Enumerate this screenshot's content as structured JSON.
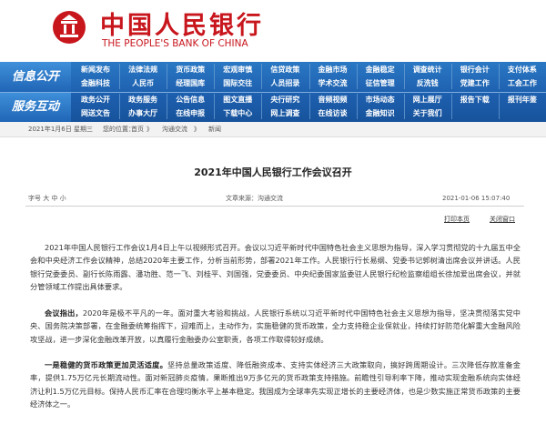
{
  "header": {
    "logo_cn": "中国人民银行",
    "logo_en": "THE PEOPLE'S BANK OF CHINA"
  },
  "nav": {
    "info_label": "信息公开",
    "service_label": "服务互动",
    "row1": [
      "新闻发布",
      "法律法规",
      "货币政策",
      "宏观审慎",
      "信贷政策",
      "金融市场",
      "金融稳定",
      "调查统计",
      "银行会计",
      "支付体系"
    ],
    "row2": [
      "金融科技",
      "人民币",
      "经理国库",
      "国际交往",
      "人员招录",
      "学术交流",
      "征信管理",
      "反洗钱",
      "党建工作",
      "工会工作"
    ],
    "row3": [
      "政务公开",
      "政务服务",
      "公告信息",
      "图文直播",
      "央行研究",
      "音频视频",
      "市场动态",
      "网上展厅",
      "报告下载",
      "报刊年鉴"
    ],
    "row4": [
      "网送文告",
      "办事大厅",
      "在线申报",
      "下载中心",
      "网上调查",
      "在线访谈",
      "金融知识",
      "关于我们"
    ]
  },
  "breadcrumb": {
    "date": "2021年1月6日 星期三",
    "label": "您的位置：",
    "home": "首页",
    "sep1": "》",
    "section": "沟通交流",
    "sep2": "》",
    "current": "新闻"
  },
  "article": {
    "title": "2021年中国人民银行工作会议召开",
    "font_size": "字号 大 中 小",
    "source": "文章来源：沟通交流",
    "datetime": "2021-01-06 15:07:40",
    "print": "打印本页",
    "close": "关闭窗口",
    "p1": "2021年中国人民银行工作会议1月4日上午以视频形式召开。会议以习近平新时代中国特色社会主义思想为指导，深入学习贯彻党的十九届五中全会和中央经济工作会议精神，总结2020年主要工作，分析当前形势，部署2021年工作。人民银行行长易纲、党委书记郭树清出席会议并讲话。人民银行党委委员、副行长陈雨露、潘功胜、范一飞、刘桂平、刘国强，党委委员、中央纪委国家监委驻人民银行纪检监察组组长徐加爱出席会议，并就分管领域工作提出具体要求。",
    "p2_lead": "会议指出，",
    "p2": "2020年是极不平凡的一年。面对重大考验和挑战，人民银行系统以习近平新时代中国特色社会主义思想为指导，坚决贯彻落实党中央、国务院决策部署，在金融委统筹指挥下，迎难而上，主动作为，实施稳健的货币政策，全力支持稳企业保就业，持续打好防范化解重大金融风险攻坚战，进一步深化金融改革开放，以真履行金融委办公室职责，各项工作取得较好成绩。",
    "p3_lead": "一是稳健的货币政策更加灵活适度。",
    "p3": "坚持总量政策适度、降低融资成本、支持实体经济三大政策取向，搞好跨周期设计。三次降低存款准备金率，提供1.75万亿元长期流动性。面对新冠肺炎疫情，果断推出9万多亿元的货币政策支持措施。前瞻性引导利率下降，推动实现金融系统向实体经济让利1.5万亿元目标。保持人民币汇率在合理均衡水平上基本稳定。我国成为全球率先实现正增长的主要经济体，也是少数实施正常货币政策的主要经济体之一。"
  },
  "colors": {
    "brand_red": "#c8161d",
    "nav_blue": "#1d5fae"
  }
}
